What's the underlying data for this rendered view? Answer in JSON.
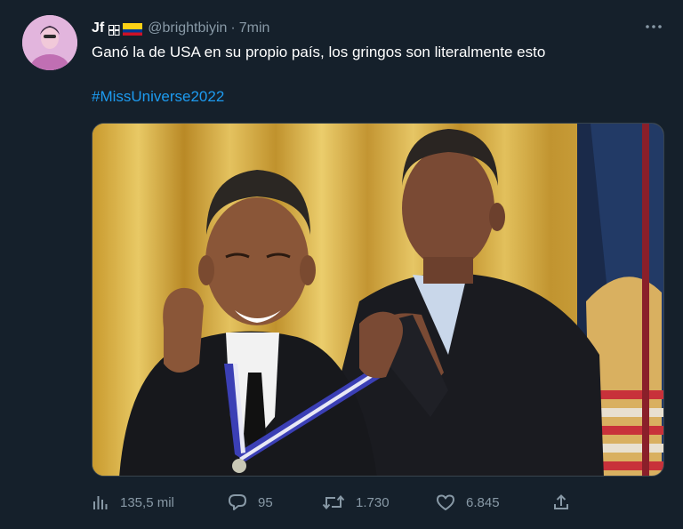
{
  "tweet": {
    "display_name": "Jf",
    "handle": "@brightbiyin",
    "separator": "·",
    "time": "7min",
    "text": "Ganó la de USA en su propio país, los gringos son literalmente esto",
    "hashtag": "#MissUniverse2022",
    "media_description": "two-men-medal-meme-photo"
  },
  "actions": {
    "views": "135,5 mil",
    "replies": "95",
    "retweets": "1.730",
    "likes": "6.845"
  },
  "colors": {
    "background": "#15202b",
    "text": "#ffffff",
    "secondary": "#8899a6",
    "link": "#1d9bf0"
  },
  "icons": [
    "more-icon",
    "views-icon",
    "reply-icon",
    "retweet-icon",
    "like-icon",
    "share-icon",
    "flag-icon",
    "emoji-icon"
  ]
}
